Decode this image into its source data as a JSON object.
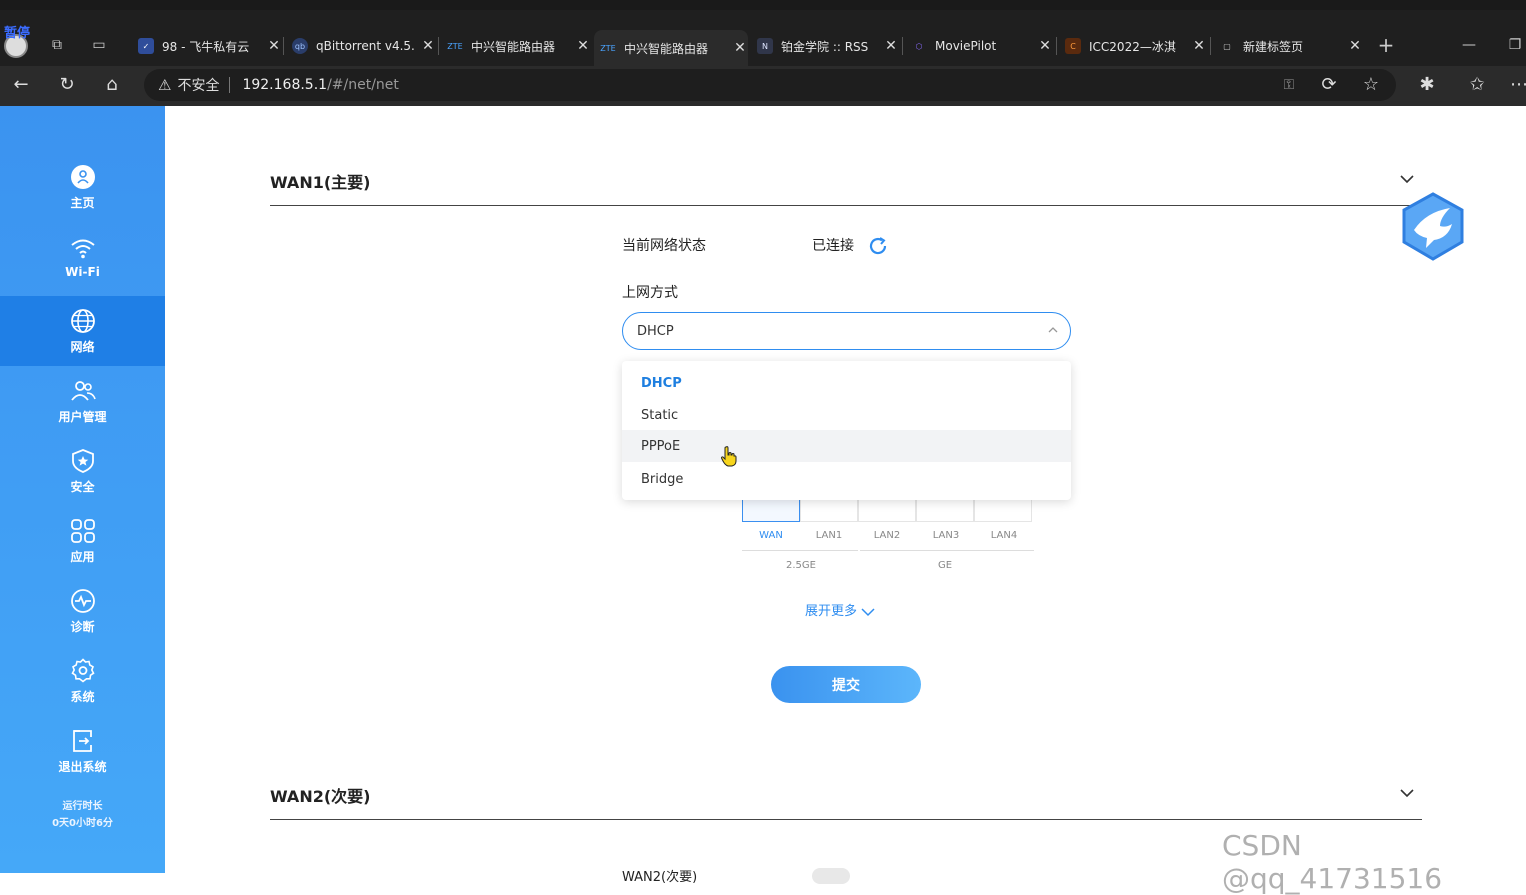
{
  "browser": {
    "overlay_badge": "暂停",
    "tabs": [
      {
        "title": "98 - 飞牛私有云",
        "fav": "✓"
      },
      {
        "title": "qBittorrent v4.5.",
        "fav": "qb"
      },
      {
        "title": "中兴智能路由器",
        "fav": "ZTE"
      },
      {
        "title": "中兴智能路由器",
        "fav": "ZTE"
      },
      {
        "title": "铂金学院 :: RSS",
        "fav": "N"
      },
      {
        "title": "MoviePilot",
        "fav": "⬡"
      },
      {
        "title": "ICC2022—冰淇",
        "fav": "C"
      },
      {
        "title": "新建标签页",
        "fav": "▢"
      }
    ],
    "address": {
      "security": "不安全",
      "host": "192.168.5.1",
      "path": "/#/net/net"
    }
  },
  "sidebar": {
    "items": [
      {
        "label": "主页"
      },
      {
        "label": "Wi-Fi"
      },
      {
        "label": "网络"
      },
      {
        "label": "用户管理"
      },
      {
        "label": "安全"
      },
      {
        "label": "应用"
      },
      {
        "label": "诊断"
      },
      {
        "label": "系统"
      },
      {
        "label": "退出系统"
      }
    ],
    "uptime_label": "运行时长",
    "uptime_value": "0天0小时6分"
  },
  "wan1": {
    "title": "WAN1(主要)",
    "status_label": "当前网络状态",
    "status_value": "已连接",
    "mode_label": "上网方式",
    "mode_value": "DHCP",
    "options": [
      "DHCP",
      "Static",
      "PPPoE",
      "Bridge"
    ],
    "ports": [
      "WAN",
      "LAN1",
      "LAN2",
      "LAN3",
      "LAN4"
    ],
    "port_groups": [
      "2.5GE",
      "GE"
    ],
    "expand_label": "展开更多",
    "submit_label": "提交"
  },
  "wan2": {
    "title": "WAN2(次要)",
    "sub_label": "WAN2(次要)"
  },
  "watermark": "CSDN @qq_41731516",
  "colors": {
    "accent": "#2f8df0",
    "sidebar": "#3b93f0",
    "sidebar_active": "#1f7fe6"
  }
}
